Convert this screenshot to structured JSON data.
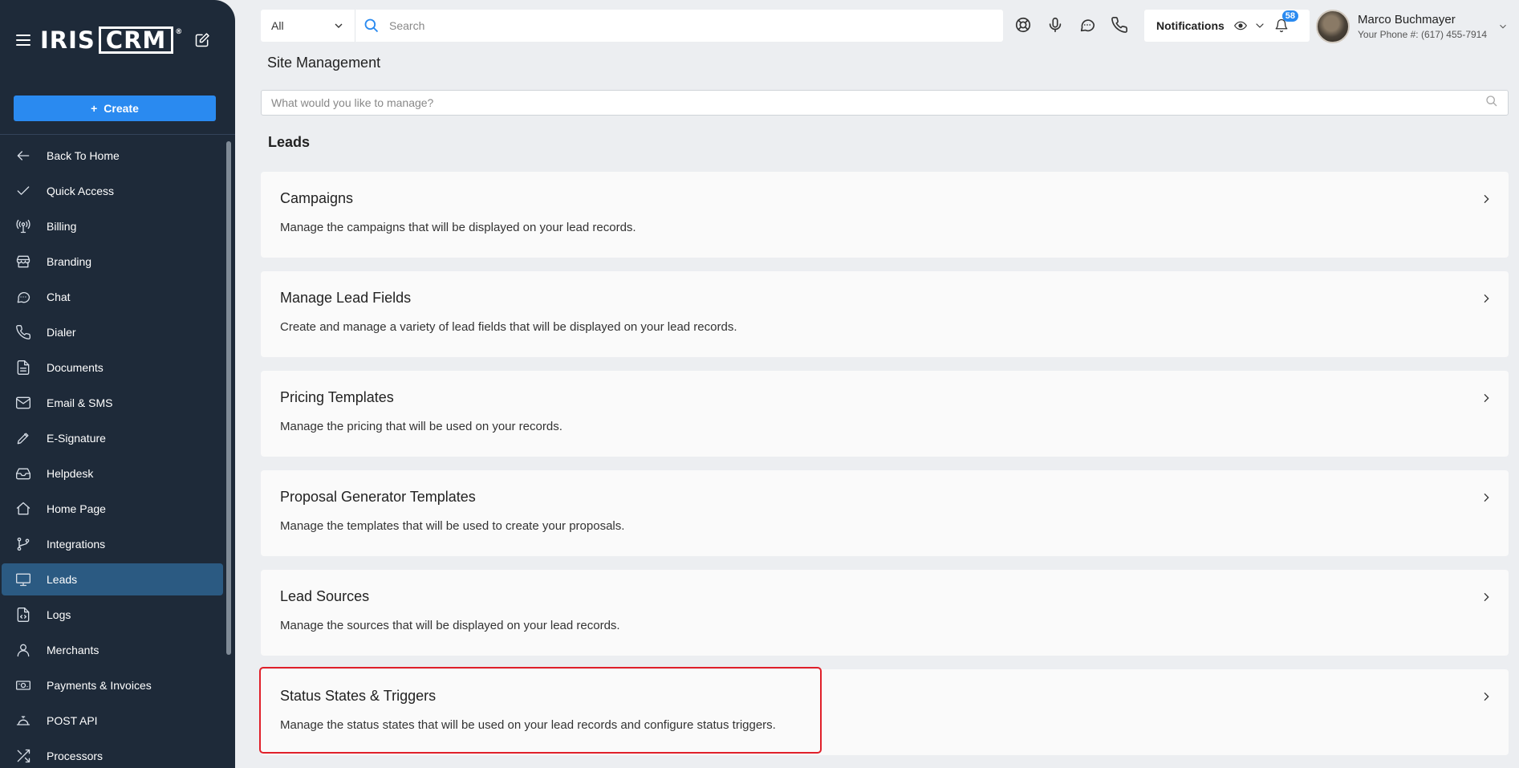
{
  "sidebar": {
    "logo_text": "IRIS",
    "logo_boxed": "CRM",
    "logo_reg": "®",
    "create_label": "Create",
    "items": [
      {
        "label": "Back To Home",
        "icon": "arrow-left-icon"
      },
      {
        "label": "Quick Access",
        "icon": "check-icon"
      },
      {
        "label": "Billing",
        "icon": "antenna-icon"
      },
      {
        "label": "Branding",
        "icon": "store-icon"
      },
      {
        "label": "Chat",
        "icon": "chat-icon"
      },
      {
        "label": "Dialer",
        "icon": "phone-icon"
      },
      {
        "label": "Documents",
        "icon": "document-icon"
      },
      {
        "label": "Email & SMS",
        "icon": "mail-icon"
      },
      {
        "label": "E-Signature",
        "icon": "pen-icon"
      },
      {
        "label": "Helpdesk",
        "icon": "inbox-icon"
      },
      {
        "label": "Home Page",
        "icon": "home-icon"
      },
      {
        "label": "Integrations",
        "icon": "branch-icon"
      },
      {
        "label": "Leads",
        "icon": "monitor-icon",
        "active": true
      },
      {
        "label": "Logs",
        "icon": "code-file-icon"
      },
      {
        "label": "Merchants",
        "icon": "user-icon"
      },
      {
        "label": "Payments & Invoices",
        "icon": "cash-icon"
      },
      {
        "label": "POST API",
        "icon": "bell-service-icon"
      },
      {
        "label": "Processors",
        "icon": "shuffle-icon"
      }
    ]
  },
  "topbar": {
    "filter_value": "All",
    "search_placeholder": "Search",
    "notifications_label": "Notifications",
    "notification_count": "58",
    "user_name": "Marco Buchmayer",
    "user_phone": "Your Phone #: (617) 455-7914"
  },
  "main": {
    "page_title": "Site Management",
    "manage_placeholder": "What would you like to manage?",
    "section_title": "Leads",
    "cards": [
      {
        "title": "Campaigns",
        "desc": "Manage the campaigns that will be displayed on your lead records."
      },
      {
        "title": "Manage Lead Fields",
        "desc": "Create and manage a variety of lead fields that will be displayed on your lead records."
      },
      {
        "title": "Pricing Templates",
        "desc": "Manage the pricing that will be used on your records."
      },
      {
        "title": "Proposal Generator Templates",
        "desc": "Manage the templates that will be used to create your proposals."
      },
      {
        "title": "Lead Sources",
        "desc": "Manage the sources that will be displayed on your lead records."
      },
      {
        "title": "Status States & Triggers",
        "desc": "Manage the status states that will be used on your lead records and configure status triggers."
      }
    ]
  },
  "colors": {
    "sidebar_bg": "#1e2a39",
    "accent": "#2a8af0",
    "active_item": "#2b5a82",
    "highlight": "#e0202a"
  }
}
